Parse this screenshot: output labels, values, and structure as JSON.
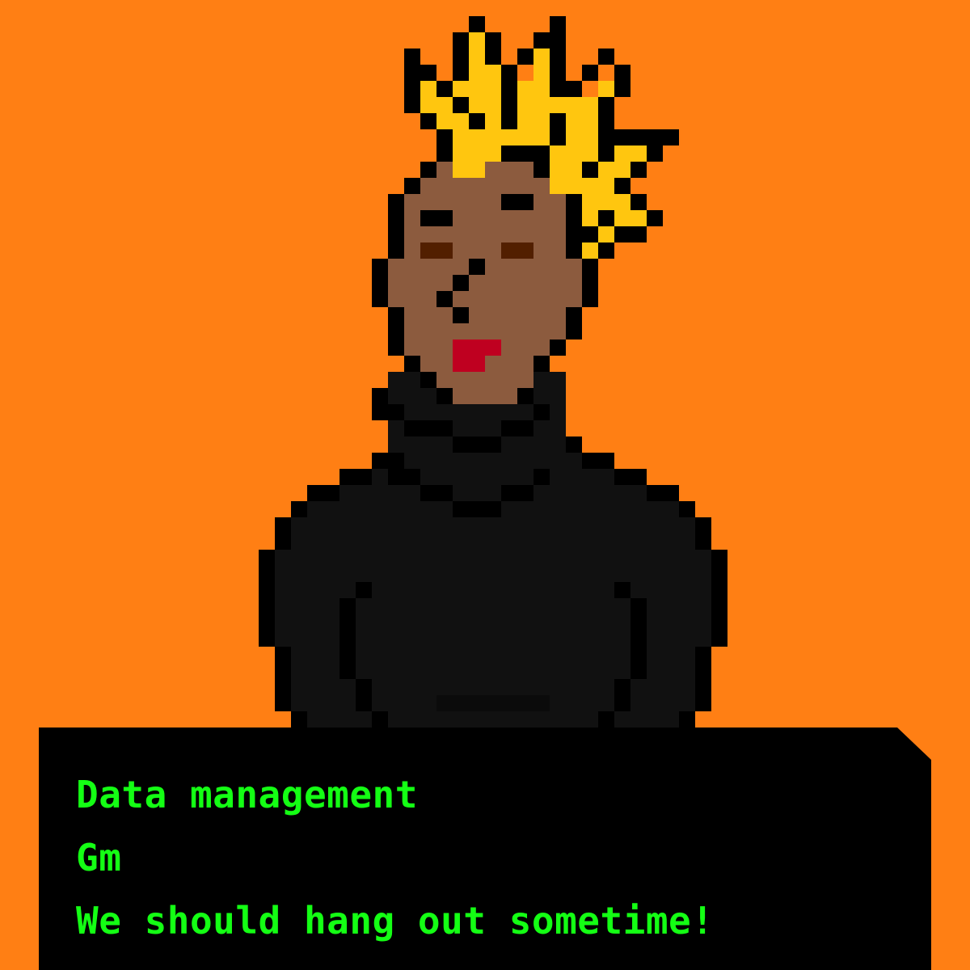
{
  "colors": {
    "background": "#FF7F14",
    "outline": "#000000",
    "hoodie": "#111111",
    "skin": "#8C5B3E",
    "hair": "#FFC60F",
    "eyes": "#521F00",
    "mouth": "#BF0020",
    "dialog_bg": "#000000",
    "dialog_text": "#14FF14"
  },
  "dialog": {
    "lines": [
      "Data management",
      "Gm",
      "We should hang out sometime!"
    ]
  }
}
